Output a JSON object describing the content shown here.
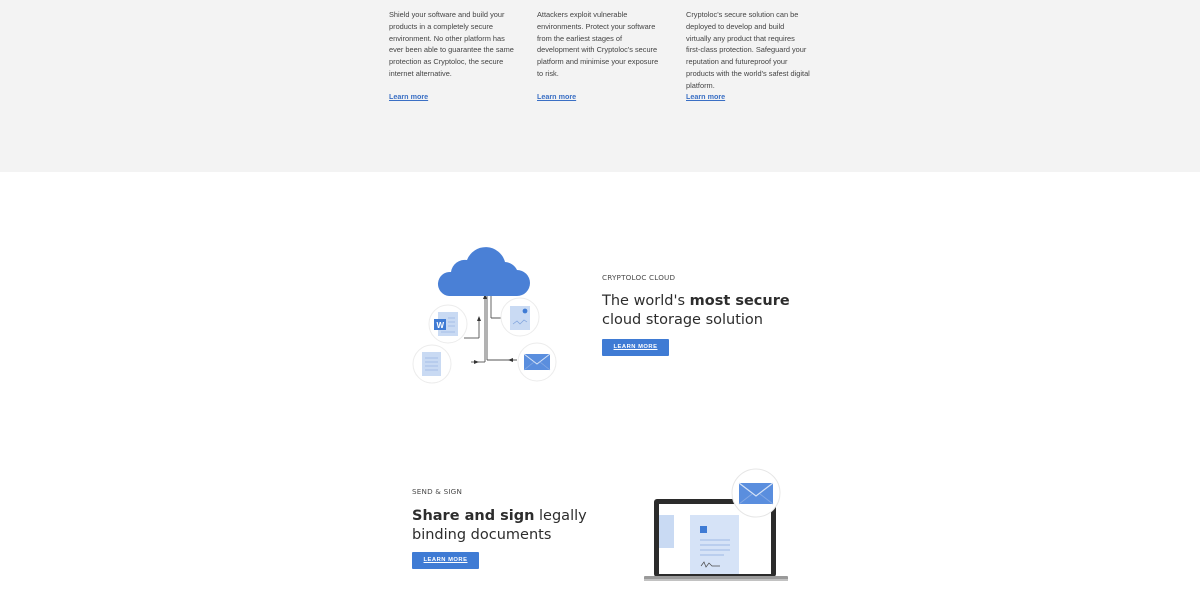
{
  "features": [
    {
      "text": "Shield your software and build your products in a completely secure environment. No other platform has ever been able to guarantee the same protection as Cryptoloc, the secure internet alternative.",
      "link": "Learn more"
    },
    {
      "text": "Attackers exploit vulnerable environments. Protect your software from the earliest stages of development with Cryptoloc's secure platform and minimise your exposure to risk.",
      "link": "Learn more"
    },
    {
      "text": "Cryptoloc's secure solution can be deployed to develop and build virtually any product that requires first-class protection. Safeguard your reputation and futureproof your products with the world's safest digital platform.",
      "link": "Learn more"
    }
  ],
  "cloud": {
    "eyebrow": "CRYPTOLOC CLOUD",
    "headline_pre": "The world's ",
    "headline_bold": "most secure",
    "headline_post": "cloud storage solution",
    "button": "LEARN MORE",
    "illustration_icons": [
      "cloud-icon",
      "word-document-icon",
      "document-icon",
      "chart-document-icon",
      "envelope-icon"
    ]
  },
  "sign": {
    "eyebrow": "SEND & SIGN",
    "headline_bold": "Share and sign",
    "headline_post1": " legally",
    "headline_post2": "binding documents",
    "button": "LEARN MORE",
    "illustration_icons": [
      "laptop-icon",
      "signed-document-icon",
      "envelope-icon"
    ]
  },
  "colors": {
    "accent": "#3f7bd4",
    "link": "#3a6fc4",
    "band": "#f3f3f3",
    "illustration_light": "#d6e3f7"
  }
}
